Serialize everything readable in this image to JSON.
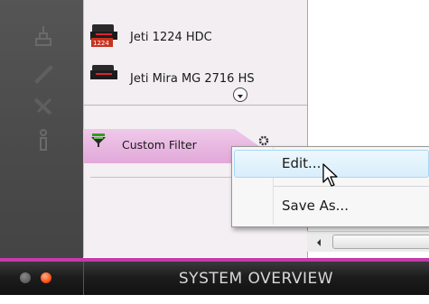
{
  "printers": [
    {
      "name": "Jeti 1224 HDC",
      "thumb_label": "1224"
    },
    {
      "name": "Jeti Mira MG 2716 HS"
    }
  ],
  "filter": {
    "label": "Custom Filter"
  },
  "context_menu": {
    "items": [
      "Edit...",
      "Save As..."
    ]
  },
  "footer": {
    "title": "SYSTEM OVERVIEW"
  },
  "colors": {
    "accent": "#c43bab",
    "filter_pill": "#e1a8d9",
    "led_on": "#ff5a1f",
    "led_off": "#5a5a5a"
  },
  "icons": [
    "scale-icon",
    "pen-icon",
    "tools-icon",
    "info-icon",
    "funnel-icon",
    "gear-icon",
    "chevron-down-icon",
    "cursor-arrow-icon"
  ]
}
